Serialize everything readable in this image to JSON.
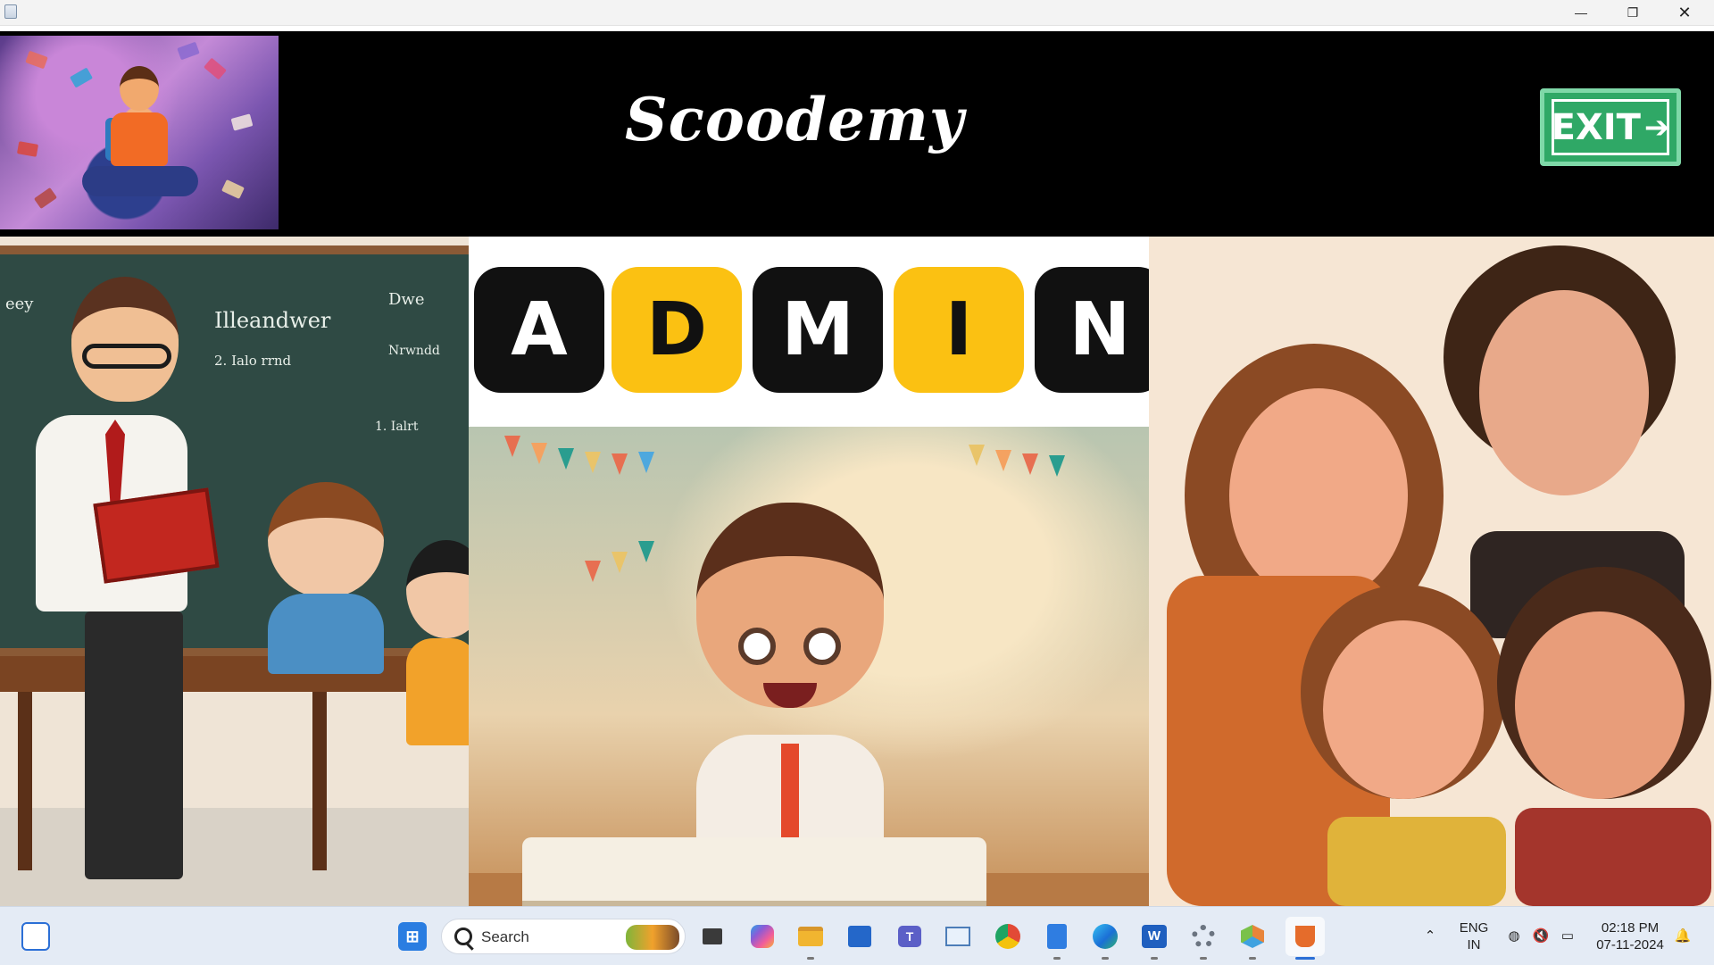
{
  "window": {
    "minimize_glyph": "—",
    "maximize_glyph": "❐",
    "close_glyph": "✕"
  },
  "header": {
    "title": "Scoodemy",
    "exit_label": "EXIT",
    "exit_arrow": "➔"
  },
  "panels": {
    "teacher": {
      "chalk_lines": [
        "Illeandwer",
        "2. Ialo rrnd",
        "Dwe",
        "Nrwndd",
        "1. Ialrt",
        "eey"
      ]
    },
    "admin": {
      "letters": [
        "A",
        "D",
        "M",
        "I",
        "N"
      ]
    }
  },
  "taskbar": {
    "search_placeholder": "Search",
    "language_line1": "ENG",
    "language_line2": "IN",
    "time": "02:18 PM",
    "date": "07-11-2024",
    "apps": [
      {
        "name": "task-view-icon",
        "color": "#3a3a3a"
      },
      {
        "name": "copilot-icon",
        "color": "#8c5bd6"
      },
      {
        "name": "file-explorer-icon",
        "color": "#f1b530"
      },
      {
        "name": "microsoft-store-icon",
        "color": "#2467c9"
      },
      {
        "name": "teams-icon",
        "color": "#5b5fc7"
      },
      {
        "name": "performance-monitor-icon",
        "color": "#7aa5d6"
      },
      {
        "name": "chrome-icon",
        "color": "#e24a36"
      },
      {
        "name": "notepad-icon",
        "color": "#2f7de1"
      },
      {
        "name": "edge-icon",
        "color": "#1b9bd6"
      },
      {
        "name": "word-icon",
        "color": "#1f5fbf"
      },
      {
        "name": "settings-icon",
        "color": "#6b7480"
      },
      {
        "name": "app-cube-icon",
        "color": "#e8843a"
      },
      {
        "name": "java-icon",
        "color": "#e56c2b"
      }
    ]
  }
}
